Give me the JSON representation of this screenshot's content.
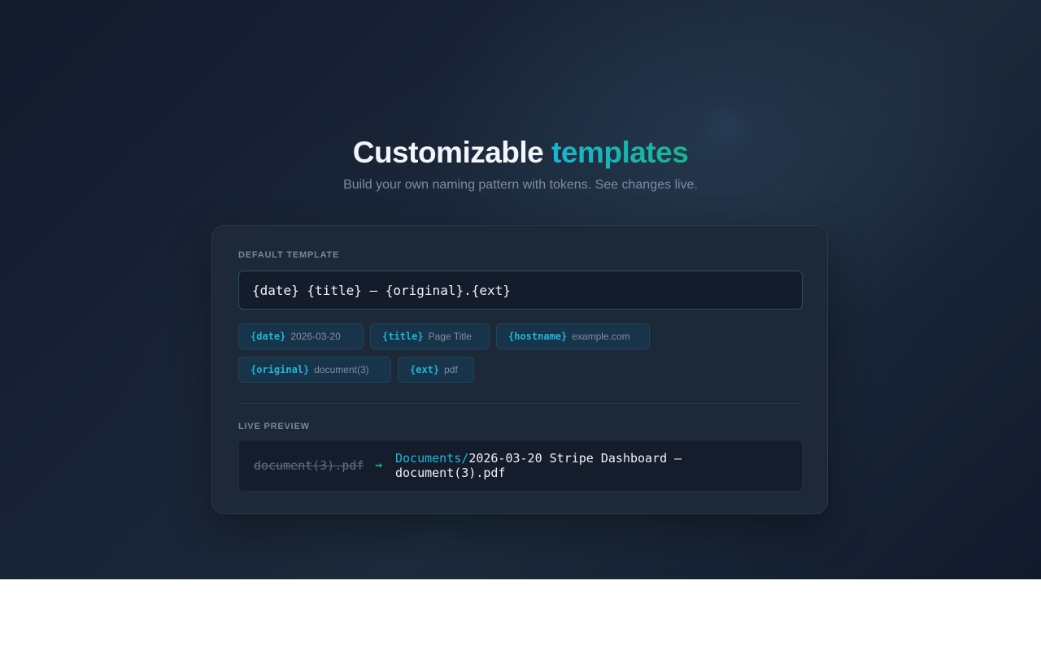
{
  "hero": {
    "title_main": "Customizable",
    "title_accent": "templates",
    "subtitle": "Build your own naming pattern with tokens. See changes live."
  },
  "template": {
    "label": "DEFAULT TEMPLATE",
    "value": "{date} {title} — {original}.{ext}"
  },
  "tokens": [
    {
      "key": "{date}",
      "example": "2026-03-20"
    },
    {
      "key": "{title}",
      "example": "Page Title"
    },
    {
      "key": "{hostname}",
      "example": "example.com"
    },
    {
      "key": "{original}",
      "example": "document(3)"
    },
    {
      "key": "{ext}",
      "example": "pdf"
    }
  ],
  "preview": {
    "label": "LIVE PREVIEW",
    "old_name": "document(3).pdf",
    "arrow": "→",
    "folder": "Documents/",
    "new_name": "2026-03-20 Stripe Dashboard — document(3).pdf"
  },
  "colors": {
    "accent_cyan": "#1fb6d6",
    "accent_green": "#17b58f",
    "card_bg": "#1d2838"
  }
}
